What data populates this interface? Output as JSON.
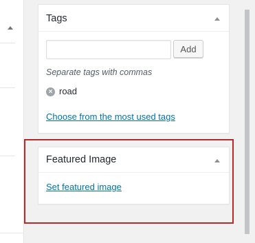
{
  "tags_box": {
    "title": "Tags",
    "input_placeholder": "",
    "add_label": "Add",
    "hint": "Separate tags with commas",
    "tags": [
      {
        "name": "road",
        "remove_icon": "x-circle-icon"
      }
    ],
    "most_used_link": "Choose from the most used tags",
    "toggle_icon": "triangle-up-icon"
  },
  "featured_image_box": {
    "title": "Featured Image",
    "link": "Set featured image",
    "toggle_icon": "triangle-up-icon"
  },
  "left_panel": {
    "toggle_icon": "triangle-up-icon"
  },
  "colors": {
    "link": "#0073aa",
    "highlight_border": "#b72a2a",
    "background": "#f1f1f1"
  }
}
